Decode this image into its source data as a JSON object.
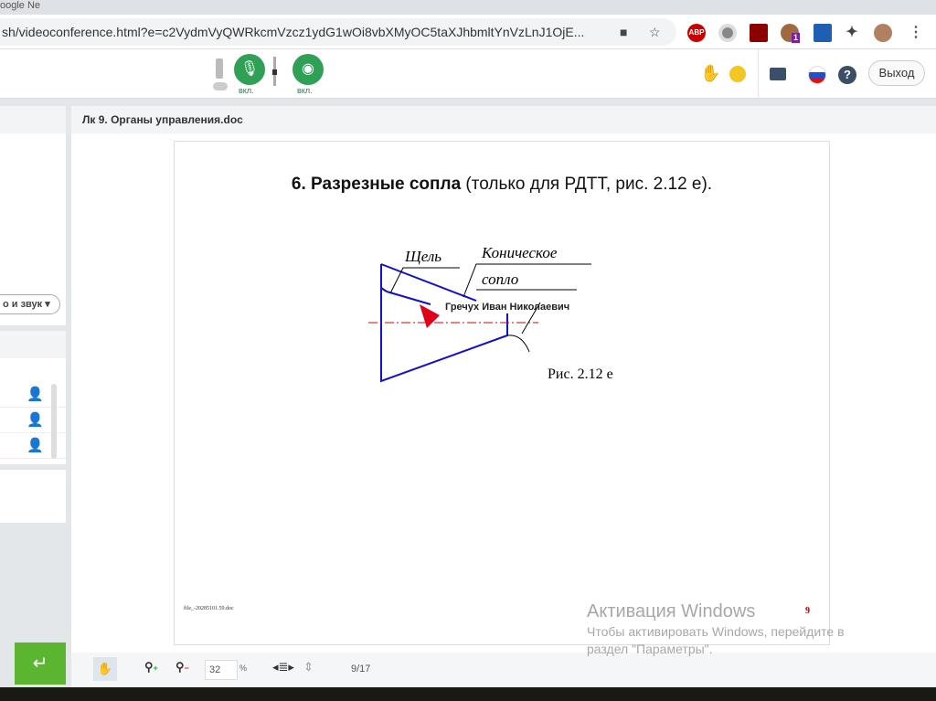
{
  "browser": {
    "tab_text": "oogle Ne",
    "url": "sh/videoconference.html?e=c2VydmVyQWRkcmVzcz1ydG1wOi8vbXMyOC5taXJhbmltYnVzLnJ1OjE...",
    "ext_badge": "1",
    "abp": "ABP"
  },
  "toolbar": {
    "mic_label": "вкл.",
    "cam_label": "вкл.",
    "exit_label": "Выход"
  },
  "left": {
    "select_label": "о и звук"
  },
  "doc": {
    "title": "Лк 9. Органы управления.doc",
    "heading_bold": "6. Разрезные сопла",
    "heading_rest": " (только для РДТТ, рис. 2.12 е).",
    "label_slot": "Щель",
    "label_cone1": "Коническое",
    "label_cone2": "сопло",
    "presenter": "Гречух Иван Николаевич",
    "caption": "Рис. 2.12 е",
    "footer_file": "file_-20285101.59.doc",
    "page_number": "9"
  },
  "bottombar": {
    "zoom": "32",
    "zoom_unit": "%",
    "page": "9/17"
  },
  "watermark": {
    "title": "Активация Windows",
    "line1": "Чтобы активировать Windows, перейдите в",
    "line2": "раздел \"Параметры\"."
  }
}
